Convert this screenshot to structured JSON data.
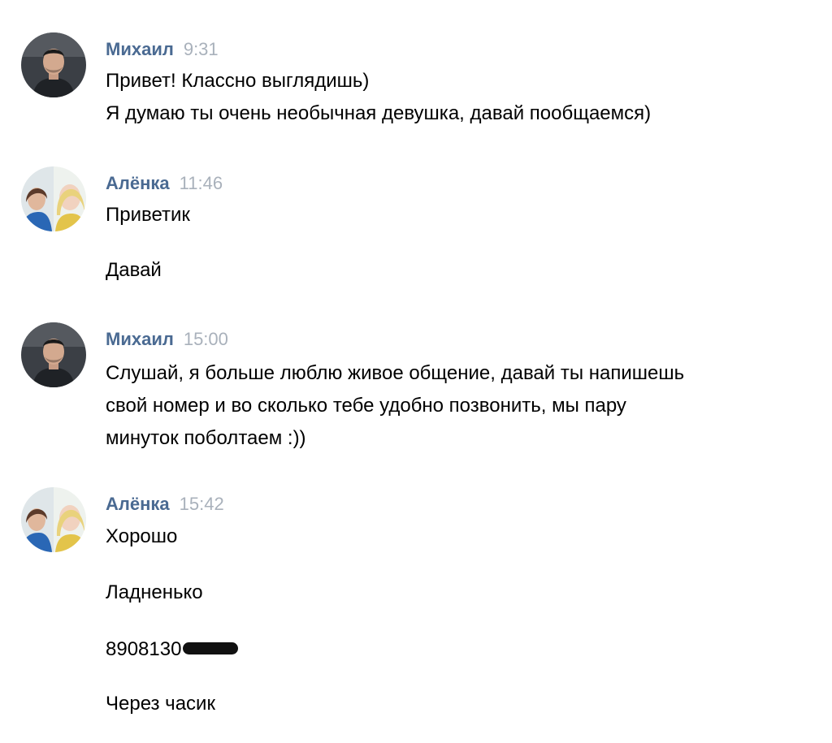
{
  "messages": [
    {
      "author": "Михаил",
      "time": "9:31",
      "avatar": "mikhail-avatar",
      "lines": [
        "Привет! Классно выглядишь)",
        "Я думаю ты очень необычная девушка, давай пообщаемся)"
      ]
    },
    {
      "author": "Алёнка",
      "time": "11:46",
      "avatar": "alyonka-avatar",
      "lines": [
        "Приветик",
        "Давай"
      ]
    },
    {
      "author": "Михаил",
      "time": "15:00",
      "avatar": "mikhail-avatar",
      "lines": [
        "Слушай, я больше люблю живое общение, давай ты напишешь",
        "свой номер и во сколько тебе удобно позвонить, мы пару",
        "минуток поболтаем :))"
      ]
    },
    {
      "author": "Алёнка",
      "time": "15:42",
      "avatar": "alyonka-avatar",
      "lines": [
        "Хорошо",
        "Ладненько",
        "8908130",
        "Через часик"
      ]
    }
  ],
  "colors": {
    "author": "#4a6a92",
    "time": "#a9b1bb",
    "text": "#000000",
    "redaction": "#111111"
  }
}
